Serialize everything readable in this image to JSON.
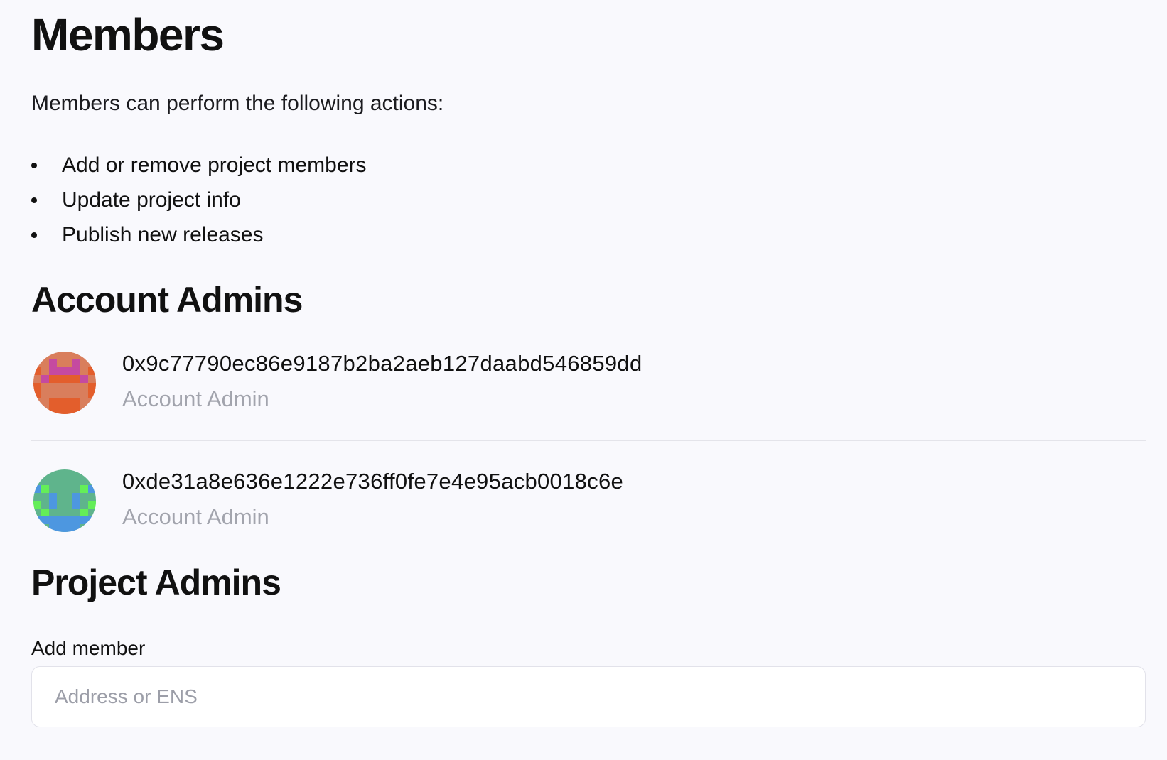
{
  "title": "Members",
  "intro": "Members can perform the following actions:",
  "actions": [
    "Add or remove project members",
    "Update project info",
    "Publish new releases"
  ],
  "account_admins": {
    "heading": "Account Admins",
    "members": [
      {
        "address": "0x9c77790ec86e9187b2ba2aeb127daabd546859dd",
        "role": "Account Admin",
        "avatar_icon": "identicon-orange",
        "avatar_colors": [
          "#d97e5c",
          "#e35e2c",
          "#c54aa0"
        ]
      },
      {
        "address": "0xde31a8e636e1222e736ff0fe7e4e95acb0018c6e",
        "role": "Account Admin",
        "avatar_icon": "identicon-green",
        "avatar_colors": [
          "#5fb48c",
          "#4d97e0",
          "#64ee58"
        ]
      }
    ]
  },
  "project_admins": {
    "heading": "Project Admins",
    "add_member_label": "Add member",
    "add_member_placeholder": "Address or ENS",
    "add_member_value": ""
  }
}
